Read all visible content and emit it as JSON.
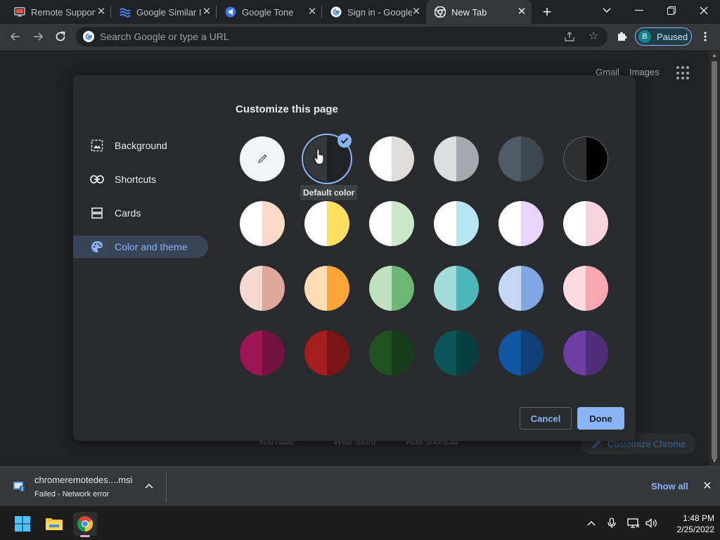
{
  "tabs": [
    {
      "title": "Remote Support",
      "icon": "remote-desktop-icon",
      "active": false
    },
    {
      "title": "Google Similar I",
      "icon": "waves-icon",
      "active": false
    },
    {
      "title": "Google Tone",
      "icon": "google-tone-icon",
      "active": false
    },
    {
      "title": "Sign in - Google",
      "icon": "google-g-icon",
      "active": false
    },
    {
      "title": "New Tab",
      "icon": "chrome-icon",
      "active": true
    }
  ],
  "toolbar": {
    "omnibox_placeholder": "Search Google or type a URL",
    "profile_initial": "B",
    "profile_status": "Paused"
  },
  "ntp": {
    "gmail": "Gmail",
    "images": "Images",
    "shortcut_youtube": "YouTube",
    "shortcut_webstore": "Web Store",
    "shortcut_add": "Add shortcut",
    "customize_chrome": "Customize Chrome"
  },
  "dialog": {
    "title": "Customize this page",
    "menu": [
      {
        "label": "Background",
        "icon": "image-icon",
        "selected": false
      },
      {
        "label": "Shortcuts",
        "icon": "link-icon",
        "selected": false
      },
      {
        "label": "Cards",
        "icon": "cards-icon",
        "selected": false
      },
      {
        "label": "Color and theme",
        "icon": "palette-icon",
        "selected": true
      }
    ],
    "tooltip": "Default color",
    "cancel_label": "Cancel",
    "done_label": "Done",
    "swatches": [
      {
        "type": "custom",
        "left": "#f1f3f4",
        "right": "#f1f3f4",
        "selected": false
      },
      {
        "type": "default",
        "left": "#35363a",
        "right": "#202124",
        "selected": true
      },
      {
        "type": "color",
        "left": "#ffffff",
        "right": "#e3dbd9",
        "selected": false
      },
      {
        "type": "color",
        "left": "#dcdde1",
        "right": "#a6a9b1",
        "selected": false
      },
      {
        "type": "color",
        "left": "#4f5b66",
        "right": "#3b464f",
        "selected": false
      },
      {
        "type": "color",
        "left": "#2e2f31",
        "right": "#000000",
        "selected": false
      },
      {
        "type": "color",
        "left": "#ffffff",
        "right": "#fbd9c8",
        "selected": false
      },
      {
        "type": "color",
        "left": "#ffffff",
        "right": "#fedf5f",
        "selected": false
      },
      {
        "type": "color",
        "left": "#ffffff",
        "right": "#c9e8c5",
        "selected": false
      },
      {
        "type": "color",
        "left": "#ffffff",
        "right": "#b6e7f3",
        "selected": false
      },
      {
        "type": "color",
        "left": "#ffffff",
        "right": "#e8d3fb",
        "selected": false
      },
      {
        "type": "color",
        "left": "#ffffff",
        "right": "#f7d3de",
        "selected": false
      },
      {
        "type": "color",
        "left": "#f3d8d2",
        "right": "#e0a898",
        "selected": false
      },
      {
        "type": "color",
        "left": "#fedbb4",
        "right": "#fba43a",
        "selected": false
      },
      {
        "type": "color",
        "left": "#c0e1c0",
        "right": "#6db673",
        "selected": false
      },
      {
        "type": "color",
        "left": "#a6dbdd",
        "right": "#4eb7bb",
        "selected": false
      },
      {
        "type": "color",
        "left": "#c4d7f5",
        "right": "#7fa7e3",
        "selected": false
      },
      {
        "type": "color",
        "left": "#fcdbe0",
        "right": "#f9a6b2",
        "selected": false
      },
      {
        "type": "color",
        "left": "#9c1553",
        "right": "#73123e",
        "selected": false
      },
      {
        "type": "color",
        "left": "#a51c1c",
        "right": "#7b1515",
        "selected": false
      },
      {
        "type": "color",
        "left": "#205222",
        "right": "#173c19",
        "selected": false
      },
      {
        "type": "color",
        "left": "#0b5558",
        "right": "#073e41",
        "selected": false
      },
      {
        "type": "color",
        "left": "#1356a0",
        "right": "#0e3e74",
        "selected": false
      },
      {
        "type": "color",
        "left": "#6e3fa3",
        "right": "#502e77",
        "selected": false
      }
    ]
  },
  "download": {
    "filename": "chromeremotedes....msi",
    "status": "Failed - Network error",
    "show_all": "Show all"
  },
  "taskbar": {
    "time": "1:48 PM",
    "date": "2/25/2022"
  }
}
